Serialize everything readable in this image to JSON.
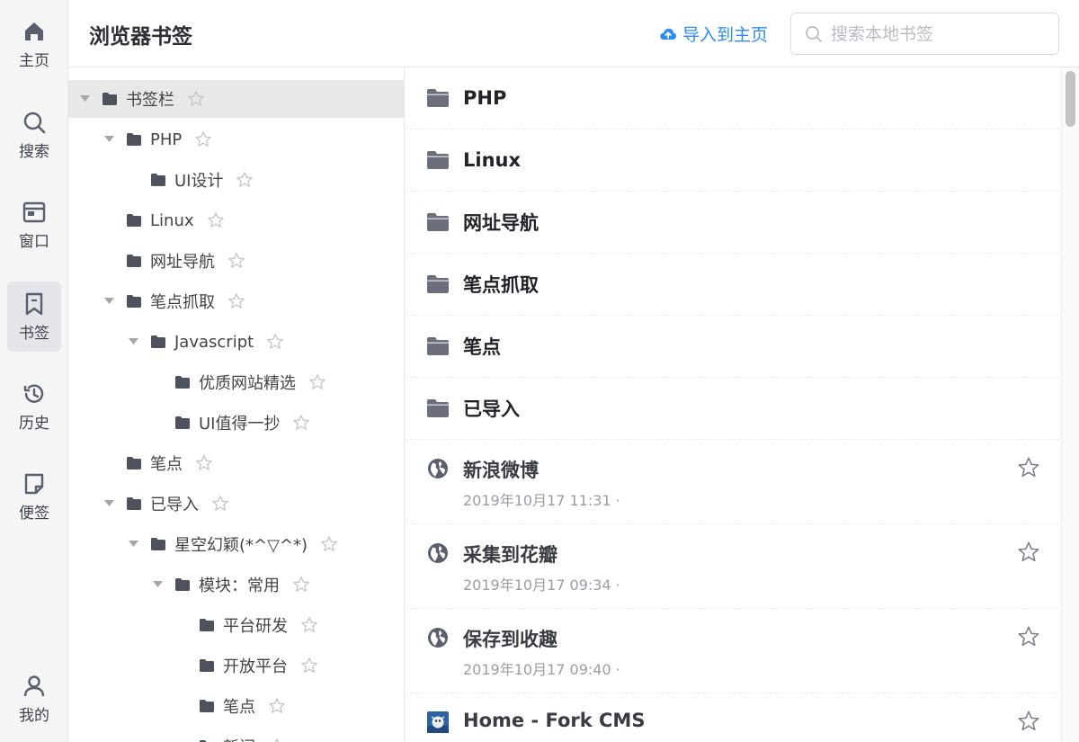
{
  "nav": {
    "items": [
      {
        "label": "主页",
        "icon": "home-icon"
      },
      {
        "label": "搜索",
        "icon": "search-icon"
      },
      {
        "label": "窗口",
        "icon": "window-icon"
      },
      {
        "label": "书签",
        "icon": "bookmark-icon",
        "active": true
      },
      {
        "label": "历史",
        "icon": "history-icon"
      },
      {
        "label": "便签",
        "icon": "note-icon"
      },
      {
        "label": "我的",
        "icon": "user-icon"
      }
    ]
  },
  "header": {
    "title": "浏览器书签",
    "import_label": "导入到主页",
    "search_placeholder": "搜索本地书签"
  },
  "tree": [
    {
      "label": "书签栏",
      "depth": 0,
      "expanded": true,
      "selected": true
    },
    {
      "label": "PHP",
      "depth": 1,
      "expanded": true
    },
    {
      "label": "UI设计",
      "depth": 2,
      "expanded": false
    },
    {
      "label": "Linux",
      "depth": 1,
      "expanded": false
    },
    {
      "label": "网址导航",
      "depth": 1,
      "expanded": false
    },
    {
      "label": "笔点抓取",
      "depth": 1,
      "expanded": true
    },
    {
      "label": "Javascript",
      "depth": 2,
      "expanded": true
    },
    {
      "label": "优质网站精选",
      "depth": 3,
      "expanded": false
    },
    {
      "label": "UI值得一抄",
      "depth": 3,
      "expanded": false
    },
    {
      "label": "笔点",
      "depth": 1,
      "expanded": false
    },
    {
      "label": "已导入",
      "depth": 1,
      "expanded": true
    },
    {
      "label": "星空幻颖(*^▽^*)",
      "depth": 2,
      "expanded": true
    },
    {
      "label": "模块：常用",
      "depth": 3,
      "expanded": true
    },
    {
      "label": "平台研发",
      "depth": 4,
      "expanded": false
    },
    {
      "label": "开放平台",
      "depth": 4,
      "expanded": false
    },
    {
      "label": "笔点",
      "depth": 4,
      "expanded": false
    },
    {
      "label": "新闻",
      "depth": 4,
      "expanded": false
    }
  ],
  "folders": [
    {
      "name": "PHP"
    },
    {
      "name": "Linux"
    },
    {
      "name": "网址导航"
    },
    {
      "name": "笔点抓取"
    },
    {
      "name": "笔点"
    },
    {
      "name": "已导入"
    }
  ],
  "bookmarks": [
    {
      "name": "新浪微博",
      "date": "2019年10月17 11:31 ·",
      "icon": "globe-icon"
    },
    {
      "name": "采集到花瓣",
      "date": "2019年10月17 09:34 ·",
      "icon": "globe-icon"
    },
    {
      "name": "保存到收趣",
      "date": "2019年10月17 09:40 ·",
      "icon": "globe-icon"
    },
    {
      "name": "Home - Fork CMS",
      "date": "",
      "icon": "fork-cms-favicon-icon"
    }
  ],
  "colors": {
    "accent": "#2d8cf0",
    "rail_bg": "#f5f5f6",
    "selected_bg": "#e8e8ea",
    "folder_icon": "#6b6f7c"
  }
}
